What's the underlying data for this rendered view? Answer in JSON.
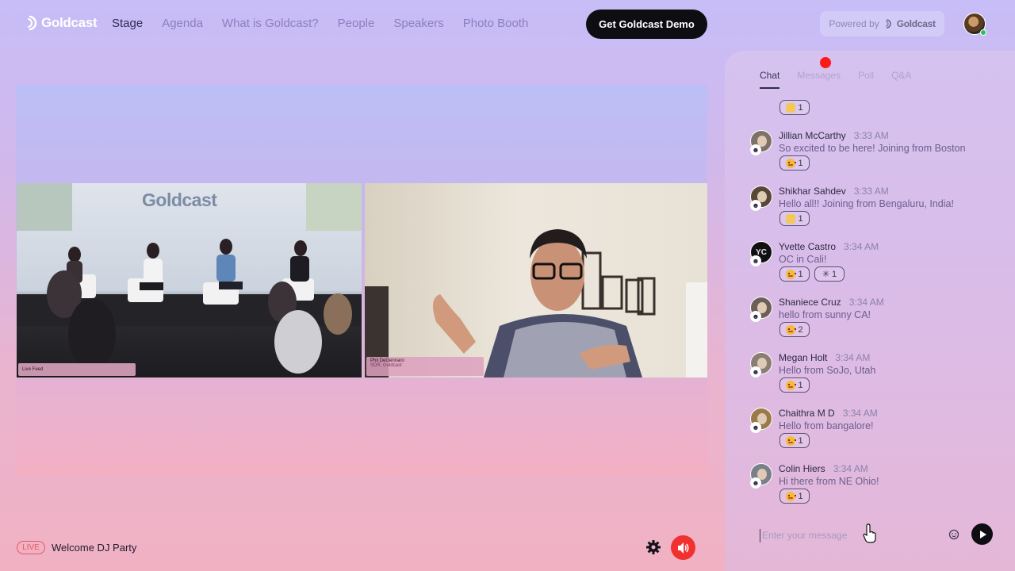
{
  "header": {
    "logo_text": "Goldcast",
    "nav": [
      "Stage",
      "Agenda",
      "What is Goldcast?",
      "People",
      "Speakers",
      "Photo Booth"
    ],
    "active_nav": "Stage",
    "demo_button": "Get Goldcast Demo",
    "powered_by_label": "Powered by",
    "powered_by_brand": "Goldcast"
  },
  "stage": {
    "left_video_logo": "Goldcast",
    "left_video_label": "Live Feed",
    "right_video_name": "Phil DeGennaro",
    "right_video_role": "SDR, Goldcast"
  },
  "bottom": {
    "live_badge": "LIVE",
    "event_title": "Welcome DJ Party"
  },
  "chat": {
    "tabs": [
      "Chat",
      "Messages",
      "Poll",
      "Q&A"
    ],
    "active_tab": "Chat",
    "top_reaction_count": "1",
    "messages": [
      {
        "name": "Jillian McCarthy",
        "time": "3:33 AM",
        "text": "So excited to be here! Joining from Boston",
        "reactions": [
          {
            "icon": "grin-face-icon",
            "count": "1"
          }
        ]
      },
      {
        "name": "Shikhar Sahdev",
        "time": "3:33 AM",
        "text": "Hello all!! Joining from Bengaluru, India!",
        "reactions": [
          {
            "icon": "cat-face-icon",
            "count": "1"
          }
        ]
      },
      {
        "name": "Yvette Castro",
        "time": "3:34 AM",
        "text": "OC in Cali!",
        "initials": "YC",
        "reactions": [
          {
            "icon": "grin-face-icon",
            "count": "1"
          },
          {
            "icon": "sparkle-icon",
            "count": "1"
          }
        ]
      },
      {
        "name": "Shaniece Cruz",
        "time": "3:34 AM",
        "text": "hello from sunny CA!",
        "reactions": [
          {
            "icon": "grin-face-icon",
            "count": "2"
          }
        ]
      },
      {
        "name": "Megan Holt",
        "time": "3:34 AM",
        "text": "Hello from SoJo, Utah",
        "reactions": [
          {
            "icon": "grin-face-icon",
            "count": "1"
          }
        ]
      },
      {
        "name": "Chaithra M D",
        "time": "3:34 AM",
        "text": "Hello from bangalore!",
        "reactions": [
          {
            "icon": "grin-face-icon",
            "count": "1"
          }
        ]
      },
      {
        "name": "Colin Hiers",
        "time": "3:34 AM",
        "text": "Hi there from NE Ohio!",
        "reactions": [
          {
            "icon": "grin-face-icon",
            "count": "1"
          }
        ]
      }
    ],
    "input_placeholder": "Enter your message"
  },
  "colors": {
    "accent_red": "#f0312f",
    "live_red": "#e25c5c",
    "dark_button": "#0d0d12",
    "online_green": "#21c35b"
  }
}
